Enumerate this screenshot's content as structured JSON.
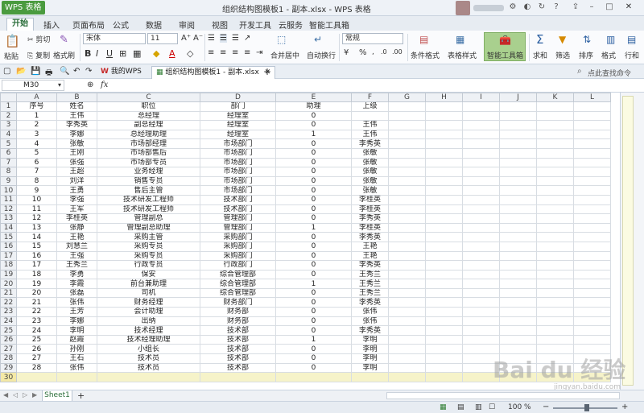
{
  "app": {
    "button": "WPS 表格",
    "title": "组织结构图模板1 - 副本.xlsx - WPS 表格"
  },
  "menus": [
    "开始",
    "插入",
    "页面布局",
    "公式",
    "数据",
    "审阅",
    "视图",
    "开发工具",
    "云服务",
    "智能工具箱"
  ],
  "ribbon": {
    "paste": "粘贴",
    "cut": "剪切",
    "copy": "复制",
    "format_painter": "格式刷",
    "font": "宋体",
    "font_size": "11",
    "merge": "合并居中",
    "wrap": "自动换行",
    "number_format": "常规",
    "percent": "%",
    "cond_format": "条件格式",
    "table_style": "表格样式",
    "smart_toolbox": "智能工具箱",
    "sum": "求和",
    "filter": "筛选",
    "sort": "排序",
    "format": "格式",
    "row_col": "行和"
  },
  "tabs": {
    "mywps": "我的WPS",
    "file": "组织结构图模板1 - 副本.xlsx",
    "search": "点此查找命令"
  },
  "formula": {
    "cell_ref": "M30",
    "fx": "fx"
  },
  "columns": [
    "A",
    "B",
    "C",
    "D",
    "E",
    "F",
    "G",
    "H",
    "I",
    "J",
    "K",
    "L"
  ],
  "headers": [
    "序号",
    "姓名",
    "职位",
    "部门",
    "助理",
    "上级"
  ],
  "rows": [
    [
      "1",
      "王伟",
      "总经理",
      "经理室",
      "0",
      ""
    ],
    [
      "2",
      "李秀英",
      "副总经理",
      "经理室",
      "0",
      "王伟"
    ],
    [
      "3",
      "李娜",
      "总经理助理",
      "经理室",
      "1",
      "王伟"
    ],
    [
      "4",
      "张敏",
      "市场部经理",
      "市场部门",
      "0",
      "李秀英"
    ],
    [
      "5",
      "王刚",
      "市场部售后",
      "市场部门",
      "0",
      "张敏"
    ],
    [
      "6",
      "张强",
      "市场部专员",
      "市场部门",
      "0",
      "张敏"
    ],
    [
      "7",
      "王超",
      "业务经理",
      "市场部门",
      "0",
      "张敏"
    ],
    [
      "8",
      "刘洋",
      "销售专员",
      "市场部门",
      "0",
      "张敏"
    ],
    [
      "9",
      "王勇",
      "售后主管",
      "市场部门",
      "0",
      "张敏"
    ],
    [
      "10",
      "李强",
      "技术研发工程师",
      "技术部门",
      "0",
      "李桂英"
    ],
    [
      "11",
      "王军",
      "技术研发工程师",
      "技术部门",
      "0",
      "李桂英"
    ],
    [
      "12",
      "李桂英",
      "管理副总",
      "管理部门",
      "0",
      "李秀英"
    ],
    [
      "13",
      "张静",
      "管理副总助理",
      "管理部门",
      "1",
      "李桂英"
    ],
    [
      "14",
      "王艳",
      "采购主管",
      "采购部门",
      "0",
      "李秀英"
    ],
    [
      "15",
      "刘慧兰",
      "采购专员",
      "采购部门",
      "0",
      "王艳"
    ],
    [
      "16",
      "王强",
      "采购专员",
      "采购部门",
      "0",
      "王艳"
    ],
    [
      "17",
      "王秀兰",
      "行政专员",
      "行政部门",
      "0",
      "李秀英"
    ],
    [
      "18",
      "李勇",
      "保安",
      "综合管理部",
      "0",
      "王秀兰"
    ],
    [
      "19",
      "李霞",
      "前台兼助理",
      "综合管理部",
      "1",
      "王秀兰"
    ],
    [
      "20",
      "张磊",
      "司机",
      "综合管理部",
      "0",
      "王秀兰"
    ],
    [
      "21",
      "张伟",
      "财务经理",
      "财务部门",
      "0",
      "李秀英"
    ],
    [
      "22",
      "王芳",
      "会计助理",
      "财务部",
      "0",
      "张伟"
    ],
    [
      "23",
      "李娜",
      "出纳",
      "财务部",
      "0",
      "张伟"
    ],
    [
      "24",
      "李明",
      "技术经理",
      "技术部",
      "0",
      "李秀英"
    ],
    [
      "25",
      "赵霞",
      "技术经理助理",
      "技术部",
      "1",
      "李明"
    ],
    [
      "26",
      "孙刚",
      "小组长",
      "技术部",
      "0",
      "李明"
    ],
    [
      "27",
      "王石",
      "技术员",
      "技术部",
      "0",
      "李明"
    ],
    [
      "28",
      "张伟",
      "技术员",
      "技术部",
      "0",
      "李明"
    ]
  ],
  "sheet": {
    "name": "Sheet1",
    "add": "+"
  },
  "status": {
    "zoom": "100 %"
  },
  "watermark": {
    "main": "Bai du 经验",
    "sub": "jingyan.baidu.com"
  }
}
